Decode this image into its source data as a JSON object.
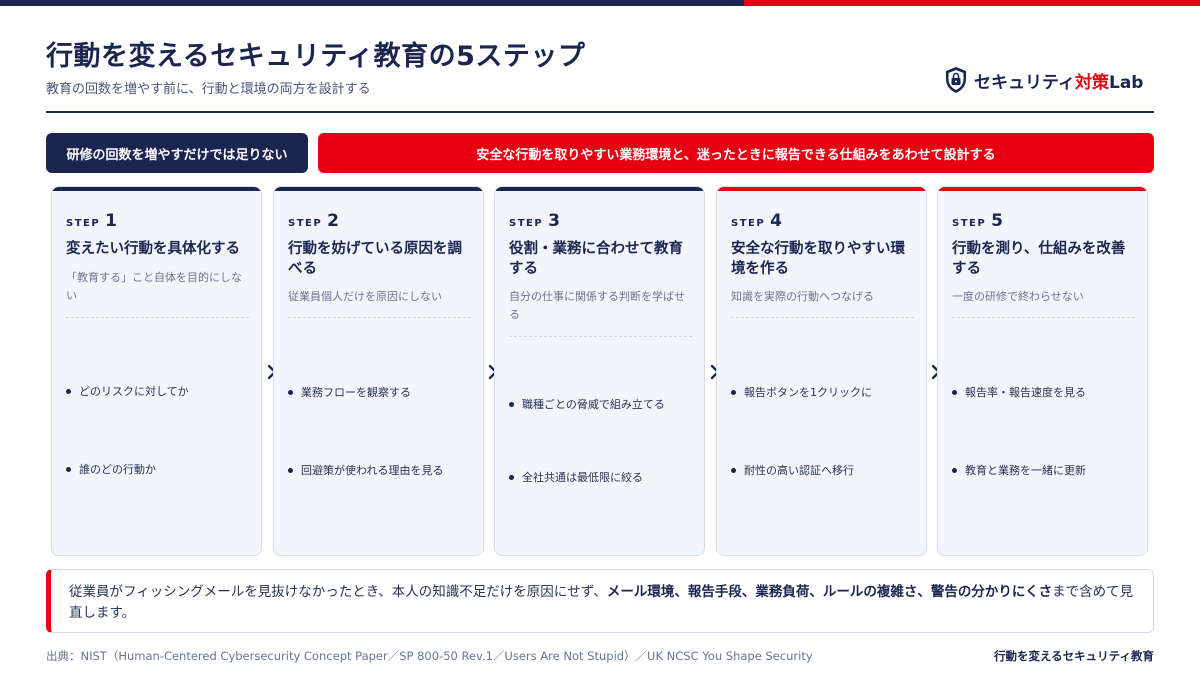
{
  "header": {
    "title": "行動を変えるセキュリティ教育の5ステップ",
    "subtitle": "教育の回数を増やす前に、行動と環境の両方を設計する"
  },
  "logo": {
    "icon": "shield-lock-icon",
    "text_main": "セキュリティ",
    "text_accent": "対策",
    "text_tail": "Lab"
  },
  "banners": {
    "left": "研修の回数を増やすだけでは足りない",
    "right": "安全な行動を取りやすい業務環境と、迷ったときに報告できる仕組みをあわせて設計する"
  },
  "steps": [
    {
      "label": "STEP",
      "num": "1",
      "title": "変えたい行動を具体化する",
      "desc": "「教育する」こと自体を目的にしない",
      "bullets": [
        "どのリスクに対してか",
        "誰のどの行動か"
      ]
    },
    {
      "label": "STEP",
      "num": "2",
      "title": "行動を妨げている原因を調べる",
      "desc": "従業員個人だけを原因にしない",
      "bullets": [
        "業務フローを観察する",
        "回避策が使われる理由を見る"
      ]
    },
    {
      "label": "STEP",
      "num": "3",
      "title": "役割・業務に合わせて教育する",
      "desc": "自分の仕事に関係する判断を学ばせる",
      "bullets": [
        "職種ごとの脅威で組み立てる",
        "全社共通は最低限に絞る"
      ]
    },
    {
      "label": "STEP",
      "num": "4",
      "title": "安全な行動を取りやすい環境を作る",
      "desc": "知識を実際の行動へつなげる",
      "bullets": [
        "報告ボタンを1クリックに",
        "耐性の高い認証へ移行"
      ]
    },
    {
      "label": "STEP",
      "num": "5",
      "title": "行動を測り、仕組みを改善する",
      "desc": "一度の研修で終わらせない",
      "bullets": [
        "報告率・報告速度を見る",
        "教育と業務を一緒に更新"
      ]
    }
  ],
  "note": {
    "t1": "従業員がフィッシングメールを見抜けなかったとき、本人の知識不足だけを原因にせず、",
    "b1": "メール環境",
    "s1": "、",
    "b2": "報告手段",
    "s2": "、",
    "b3": "業務負荷",
    "s3": "、",
    "b4": "ルールの複雑さ",
    "s4": "、",
    "b5": "警告の分かりにくさ",
    "t2": "まで含めて見直します。"
  },
  "footer": {
    "source": "出典：NIST（Human-Centered Cybersecurity Concept Paper／SP 800-50 Rev.1／Users Are Not Stupid）／UK NCSC You Shape Security",
    "right": "行動を変えるセキュリティ教育"
  },
  "colors": {
    "navy": "#1b2550",
    "red": "#e60012",
    "card_bg": "#f2f5fa"
  }
}
